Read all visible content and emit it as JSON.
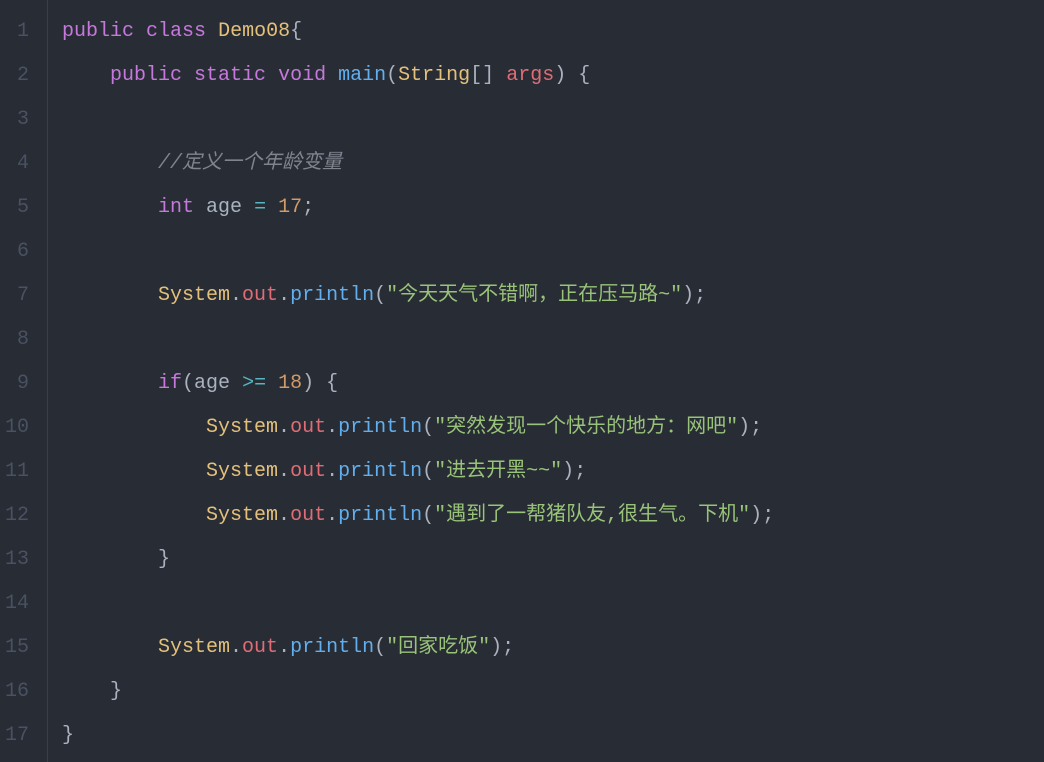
{
  "lines": {
    "n1": "1",
    "n2": "2",
    "n3": "3",
    "n4": "4",
    "n5": "5",
    "n6": "6",
    "n7": "7",
    "n8": "8",
    "n9": "9",
    "n10": "10",
    "n11": "11",
    "n12": "12",
    "n13": "13",
    "n14": "14",
    "n15": "15",
    "n16": "16",
    "n17": "17"
  },
  "code": {
    "l1": {
      "kw_public": "public",
      "kw_class": "class",
      "classname": "Demo08",
      "brace": "{"
    },
    "l2": {
      "kw_public": "public",
      "kw_static": "static",
      "kw_void": "void",
      "method": "main",
      "type": "String",
      "brackets": "[]",
      "param": "args",
      "paren_open": "(",
      "paren_close": ")",
      "brace": "{"
    },
    "l4": {
      "comment": "//定义一个年龄变量"
    },
    "l5": {
      "kw_int": "int",
      "var": "age",
      "eq": "=",
      "num": "17",
      "semi": ";"
    },
    "l7": {
      "obj": "System",
      "dot1": ".",
      "prop": "out",
      "dot2": ".",
      "call": "println",
      "paren_open": "(",
      "q1": "\"",
      "str": "今天天气不错啊，正在压马路~",
      "q2": "\"",
      "paren_close": ")",
      "semi": ";"
    },
    "l9": {
      "kw_if": "if",
      "paren_open": "(",
      "var": "age",
      "op": ">=",
      "num": "18",
      "paren_close": ")",
      "brace": "{"
    },
    "l10": {
      "obj": "System",
      "dot1": ".",
      "prop": "out",
      "dot2": ".",
      "call": "println",
      "paren_open": "(",
      "q1": "\"",
      "str": "突然发现一个快乐的地方：网吧",
      "q2": "\"",
      "paren_close": ")",
      "semi": ";"
    },
    "l11": {
      "obj": "System",
      "dot1": ".",
      "prop": "out",
      "dot2": ".",
      "call": "println",
      "paren_open": "(",
      "q1": "\"",
      "str": "进去开黑~~",
      "q2": "\"",
      "paren_close": ")",
      "semi": ";"
    },
    "l12": {
      "obj": "System",
      "dot1": ".",
      "prop": "out",
      "dot2": ".",
      "call": "println",
      "paren_open": "(",
      "q1": "\"",
      "str": "遇到了一帮猪队友,很生气。下机",
      "q2": "\"",
      "paren_close": ")",
      "semi": ";"
    },
    "l13": {
      "brace": "}"
    },
    "l15": {
      "obj": "System",
      "dot1": ".",
      "prop": "out",
      "dot2": ".",
      "call": "println",
      "paren_open": "(",
      "q1": "\"",
      "str": "回家吃饭",
      "q2": "\"",
      "paren_close": ")",
      "semi": ";"
    },
    "l16": {
      "brace": "}"
    },
    "l17": {
      "brace": "}"
    }
  }
}
